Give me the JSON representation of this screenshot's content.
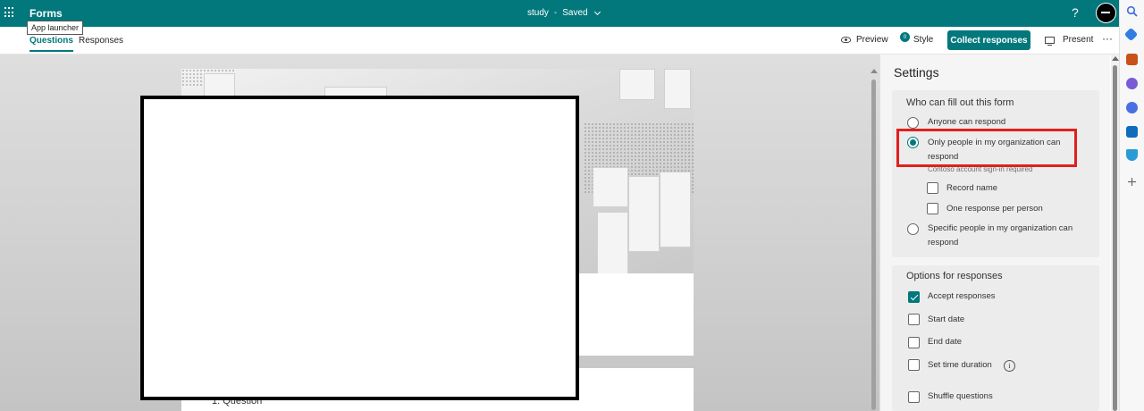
{
  "header": {
    "app_name": "Forms",
    "doc_title": "study",
    "separator": "-",
    "save_status": "Saved",
    "help_label": "?",
    "tooltip": "App launcher"
  },
  "tabs": {
    "questions": "Questions",
    "responses": "Responses"
  },
  "toolbar": {
    "preview": "Preview",
    "style": "Style",
    "style_badge": "0",
    "collect": "Collect responses",
    "present": "Present",
    "more": "···"
  },
  "canvas": {
    "question_label": "1. Question"
  },
  "settings": {
    "title": "Settings",
    "who_title": "Who can fill out this form",
    "who_options": [
      "Anyone can respond",
      "Only people in my organization can respond",
      "Specific people in my organization can respond"
    ],
    "who_selected": 1,
    "sign_in_hint": "Contoso account sign-in required",
    "sub_options": [
      "Record name",
      "One response per person"
    ],
    "options_title": "Options for responses",
    "response_options": [
      {
        "label": "Accept responses",
        "checked": true
      },
      {
        "label": "Start date",
        "checked": false
      },
      {
        "label": "End date",
        "checked": false
      },
      {
        "label": "Set time duration",
        "checked": false
      },
      {
        "label": "Shuffle questions",
        "checked": false
      }
    ],
    "info_icon": "i"
  },
  "colors": {
    "brand": "#03787c",
    "highlight": "#e0201c"
  },
  "edge_sidebar_icons": [
    "search-icon",
    "tag-icon",
    "briefcase-icon",
    "people-icon",
    "copilot-icon",
    "outlook-icon",
    "drop-icon",
    "add-icon"
  ]
}
